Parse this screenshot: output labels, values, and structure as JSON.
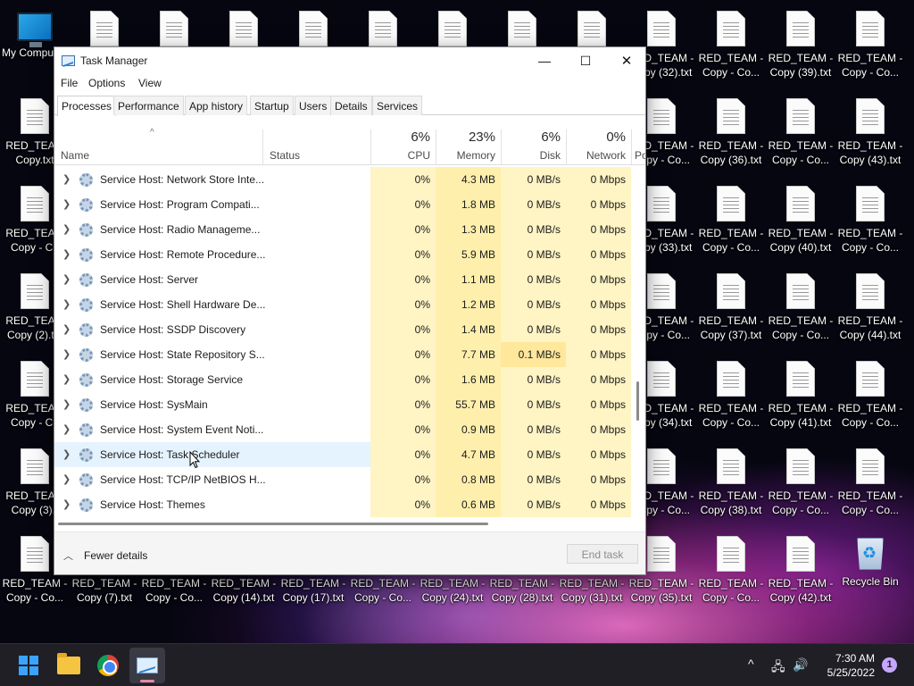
{
  "desktop": {
    "this_pc_label": "My Compu",
    "recycle_bin_label": "Recycle Bin",
    "file_icons": [
      {
        "col": 0,
        "row": 1,
        "label": "RED_TEAM\nCopy.txt"
      },
      {
        "col": 0,
        "row": 2,
        "label": "RED_TEAM\nCopy - Co"
      },
      {
        "col": 0,
        "row": 3,
        "label": "RED_TEAM\nCopy (2).txt"
      },
      {
        "col": 0,
        "row": 4,
        "label": "RED_TEAM\nCopy - Co"
      },
      {
        "col": 0,
        "row": 5,
        "label": "RED_TEAM\nCopy (3).t"
      },
      {
        "col": 0,
        "row": 6,
        "label": "RED_TEAM -\nCopy - Co..."
      },
      {
        "col": 1,
        "row": 0,
        "label": ""
      },
      {
        "col": 1,
        "row": 6,
        "label": "RED_TEAM -\nCopy (7).txt"
      },
      {
        "col": 2,
        "row": 0,
        "label": ""
      },
      {
        "col": 2,
        "row": 6,
        "label": "RED_TEAM -\nCopy - Co..."
      },
      {
        "col": 3,
        "row": 0,
        "label": ""
      },
      {
        "col": 3,
        "row": 6,
        "label": "RED_TEAM -\nCopy (14).txt"
      },
      {
        "col": 4,
        "row": 0,
        "label": ""
      },
      {
        "col": 4,
        "row": 6,
        "label": "RED_TEAM -\nCopy (17).txt"
      },
      {
        "col": 5,
        "row": 0,
        "label": ""
      },
      {
        "col": 5,
        "row": 6,
        "label": "RED_TEAM -\nCopy - Co..."
      },
      {
        "col": 6,
        "row": 0,
        "label": ""
      },
      {
        "col": 6,
        "row": 6,
        "label": "RED_TEAM -\nCopy (24).txt"
      },
      {
        "col": 7,
        "row": 0,
        "label": ""
      },
      {
        "col": 7,
        "row": 6,
        "label": "RED_TEAM -\nCopy (28).txt"
      },
      {
        "col": 8,
        "row": 0,
        "label": ""
      },
      {
        "col": 8,
        "row": 6,
        "label": "RED_TEAM -\nCopy (31).txt"
      },
      {
        "col": 9,
        "row": 0,
        "label": "RED_TEAM -\nCopy (32).txt"
      },
      {
        "col": 9,
        "row": 1,
        "label": "RED_TEAM -\nCopy - Co..."
      },
      {
        "col": 9,
        "row": 2,
        "label": "RED_TEAM -\nCopy (33).txt"
      },
      {
        "col": 9,
        "row": 3,
        "label": "RED_TEAM -\nCopy - Co..."
      },
      {
        "col": 9,
        "row": 4,
        "label": "RED_TEAM -\nCopy (34).txt"
      },
      {
        "col": 9,
        "row": 5,
        "label": "RED_TEAM -\nCopy - Co..."
      },
      {
        "col": 9,
        "row": 6,
        "label": "RED_TEAM -\nCopy (35).txt"
      },
      {
        "col": 10,
        "row": 0,
        "label": "RED_TEAM -\nCopy - Co..."
      },
      {
        "col": 10,
        "row": 1,
        "label": "RED_TEAM -\nCopy (36).txt"
      },
      {
        "col": 10,
        "row": 2,
        "label": "RED_TEAM -\nCopy - Co..."
      },
      {
        "col": 10,
        "row": 3,
        "label": "RED_TEAM -\nCopy (37).txt"
      },
      {
        "col": 10,
        "row": 4,
        "label": "RED_TEAM -\nCopy - Co..."
      },
      {
        "col": 10,
        "row": 5,
        "label": "RED_TEAM -\nCopy (38).txt"
      },
      {
        "col": 10,
        "row": 6,
        "label": "RED_TEAM -\nCopy - Co..."
      },
      {
        "col": 11,
        "row": 0,
        "label": "RED_TEAM -\nCopy (39).txt"
      },
      {
        "col": 11,
        "row": 1,
        "label": "RED_TEAM -\nCopy - Co..."
      },
      {
        "col": 11,
        "row": 2,
        "label": "RED_TEAM -\nCopy (40).txt"
      },
      {
        "col": 11,
        "row": 3,
        "label": "RED_TEAM -\nCopy - Co..."
      },
      {
        "col": 11,
        "row": 4,
        "label": "RED_TEAM -\nCopy (41).txt"
      },
      {
        "col": 11,
        "row": 5,
        "label": "RED_TEAM -\nCopy - Co..."
      },
      {
        "col": 11,
        "row": 6,
        "label": "RED_TEAM -\nCopy (42).txt"
      },
      {
        "col": 12,
        "row": 0,
        "label": "RED_TEAM -\nCopy - Co..."
      },
      {
        "col": 12,
        "row": 1,
        "label": "RED_TEAM -\nCopy (43).txt"
      },
      {
        "col": 12,
        "row": 2,
        "label": "RED_TEAM -\nCopy - Co..."
      },
      {
        "col": 12,
        "row": 3,
        "label": "RED_TEAM -\nCopy (44).txt"
      },
      {
        "col": 12,
        "row": 4,
        "label": "RED_TEAM -\nCopy - Co..."
      },
      {
        "col": 12,
        "row": 5,
        "label": "RED_TEAM -\nCopy - Co..."
      }
    ]
  },
  "window": {
    "title": "Task Manager",
    "controls": {
      "minimize": "—",
      "maximize": "☐",
      "close": "✕"
    },
    "menu": [
      "File",
      "Options",
      "View"
    ],
    "tabs": [
      "Processes",
      "Performance",
      "App history",
      "Startup",
      "Users",
      "Details",
      "Services"
    ],
    "active_tab": "Processes",
    "header": {
      "sort_arrow": "^",
      "name": "Name",
      "status": "Status",
      "cpu_pct": "6%",
      "cpu": "CPU",
      "memory_pct": "23%",
      "memory": "Memory",
      "disk_pct": "6%",
      "disk": "Disk",
      "network_pct": "0%",
      "network": "Network",
      "power": "Po"
    },
    "processes": [
      {
        "name": "Service Host: Network Store Inte...",
        "cpu": "0%",
        "memory": "4.3 MB",
        "disk": "0 MB/s",
        "network": "0 Mbps"
      },
      {
        "name": "Service Host: Program Compati...",
        "cpu": "0%",
        "memory": "1.8 MB",
        "disk": "0 MB/s",
        "network": "0 Mbps"
      },
      {
        "name": "Service Host: Radio Manageme...",
        "cpu": "0%",
        "memory": "1.3 MB",
        "disk": "0 MB/s",
        "network": "0 Mbps"
      },
      {
        "name": "Service Host: Remote Procedure...",
        "cpu": "0%",
        "memory": "5.9 MB",
        "disk": "0 MB/s",
        "network": "0 Mbps"
      },
      {
        "name": "Service Host: Server",
        "cpu": "0%",
        "memory": "1.1 MB",
        "disk": "0 MB/s",
        "network": "0 Mbps"
      },
      {
        "name": "Service Host: Shell Hardware De...",
        "cpu": "0%",
        "memory": "1.2 MB",
        "disk": "0 MB/s",
        "network": "0 Mbps"
      },
      {
        "name": "Service Host: SSDP Discovery",
        "cpu": "0%",
        "memory": "1.4 MB",
        "disk": "0 MB/s",
        "network": "0 Mbps"
      },
      {
        "name": "Service Host: State Repository S...",
        "cpu": "0%",
        "memory": "7.7 MB",
        "disk": "0.1 MB/s",
        "network": "0 Mbps"
      },
      {
        "name": "Service Host: Storage Service",
        "cpu": "0%",
        "memory": "1.6 MB",
        "disk": "0 MB/s",
        "network": "0 Mbps"
      },
      {
        "name": "Service Host: SysMain",
        "cpu": "0%",
        "memory": "55.7 MB",
        "disk": "0 MB/s",
        "network": "0 Mbps"
      },
      {
        "name": "Service Host: System Event Noti...",
        "cpu": "0%",
        "memory": "0.9 MB",
        "disk": "0 MB/s",
        "network": "0 Mbps"
      },
      {
        "name": "Service Host: Task Scheduler",
        "cpu": "0%",
        "memory": "4.7 MB",
        "disk": "0 MB/s",
        "network": "0 Mbps"
      },
      {
        "name": "Service Host: TCP/IP NetBIOS H...",
        "cpu": "0%",
        "memory": "0.8 MB",
        "disk": "0 MB/s",
        "network": "0 Mbps"
      },
      {
        "name": "Service Host: Themes",
        "cpu": "0%",
        "memory": "0.6 MB",
        "disk": "0 MB/s",
        "network": "0 Mbps"
      }
    ],
    "hovered_row": 11,
    "footer": {
      "fewer_details": "Fewer details",
      "end_task": "End task"
    }
  },
  "taskbar": {
    "icons": [
      "start-icon",
      "file-explorer-icon",
      "chrome-icon",
      "task-manager-icon"
    ],
    "tray": {
      "chevron": "^",
      "network": "🖧",
      "volume": "🔊"
    },
    "time": "7:30 AM",
    "date": "5/25/2022",
    "notification_count": "1"
  }
}
